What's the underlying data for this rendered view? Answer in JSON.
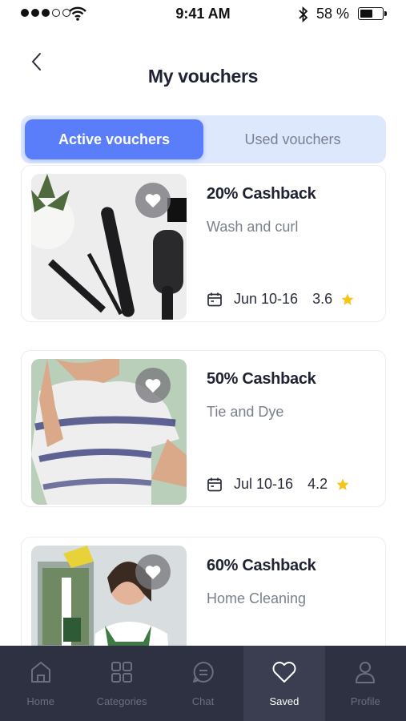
{
  "status_bar": {
    "time": "9:41 AM",
    "battery_percent": "58 %"
  },
  "header": {
    "title": "My vouchers"
  },
  "tabs": [
    {
      "label": "Active vouchers",
      "active": true
    },
    {
      "label": "Used vouchers",
      "active": false
    }
  ],
  "vouchers": [
    {
      "title": "20% Cashback",
      "subtitle": "Wash and curl",
      "date": "Jun 10-16",
      "rating": "3.6",
      "image": "hair-tools-photo"
    },
    {
      "title": "50% Cashback",
      "subtitle": "Tie and Dye",
      "date": "Jul 10-16",
      "rating": "4.2",
      "image": "tie-dye-shirt-photo"
    },
    {
      "title": "60% Cashback",
      "subtitle": "Home Cleaning",
      "image": "cleaning-photo"
    }
  ],
  "nav": [
    {
      "label": "Home",
      "icon": "home-icon"
    },
    {
      "label": "Categories",
      "icon": "grid-icon"
    },
    {
      "label": "Chat",
      "icon": "chat-icon"
    },
    {
      "label": "Saved",
      "icon": "heart-icon",
      "active": true
    },
    {
      "label": "Profile",
      "icon": "user-icon"
    }
  ],
  "colors": {
    "accent": "#5a7ef9",
    "tab_bg": "#dde8fd",
    "nav_bg": "#2d3142",
    "star": "#f5c518"
  }
}
